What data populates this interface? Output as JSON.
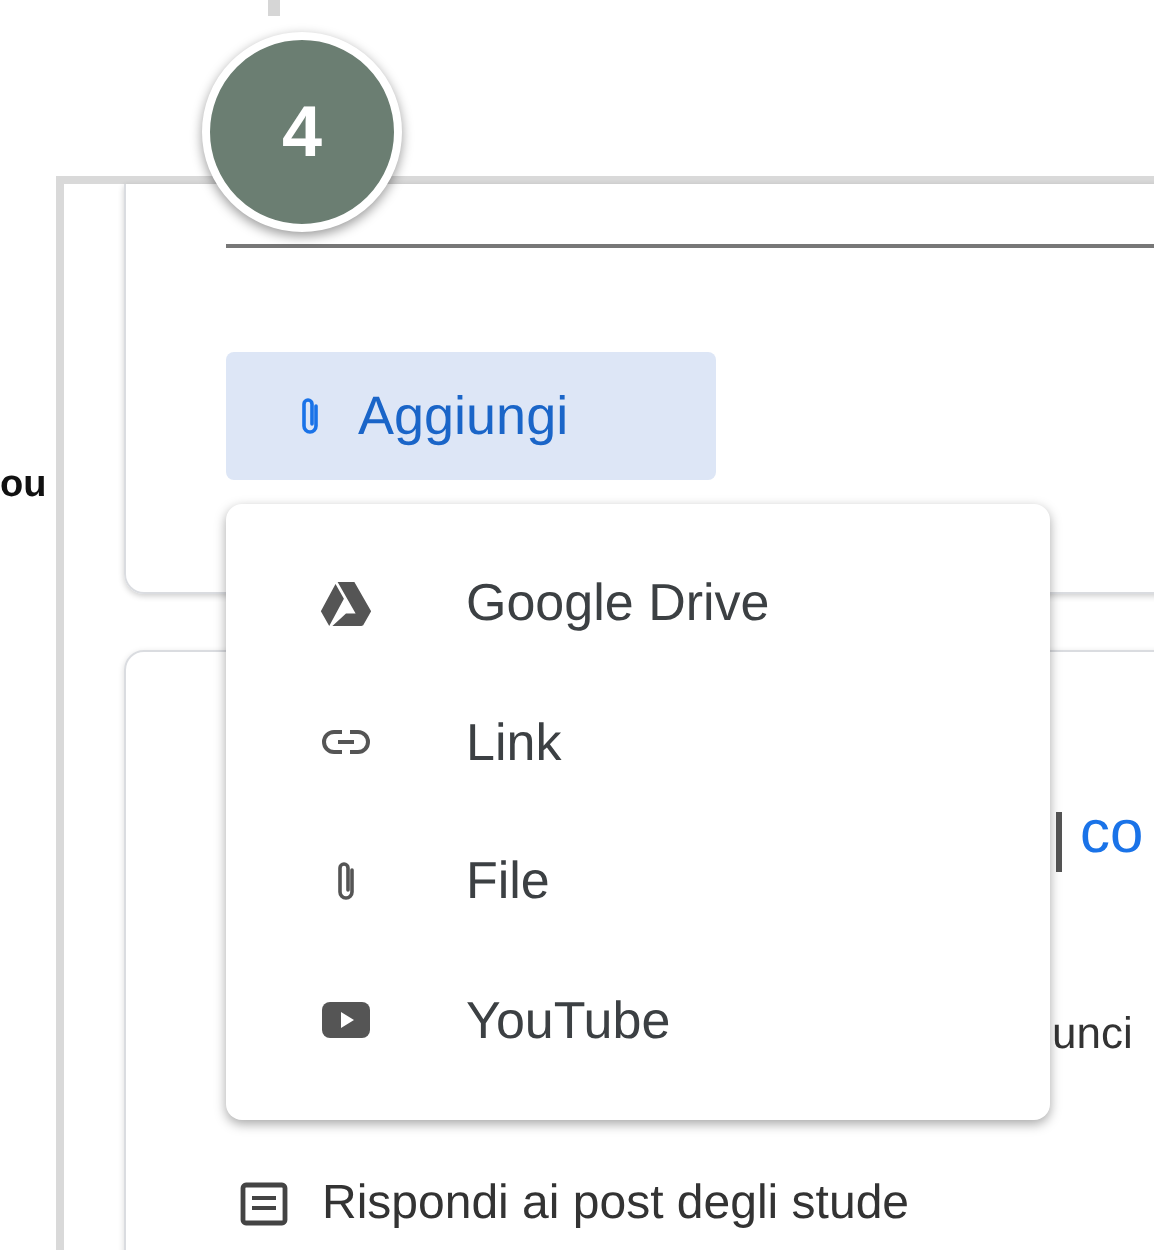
{
  "badge": {
    "number": "4"
  },
  "background_text": "ou",
  "attach_button": {
    "label": "Aggiungi"
  },
  "menu": {
    "items": [
      {
        "kind": "drive",
        "label": "Google Drive"
      },
      {
        "kind": "link",
        "label": "Link"
      },
      {
        "kind": "file",
        "label": "File"
      },
      {
        "kind": "youtube",
        "label": "YouTube"
      }
    ]
  },
  "card": {
    "heading_partial": "co",
    "text_partial": "unci",
    "option": "Rispondi ai post degli stude"
  }
}
